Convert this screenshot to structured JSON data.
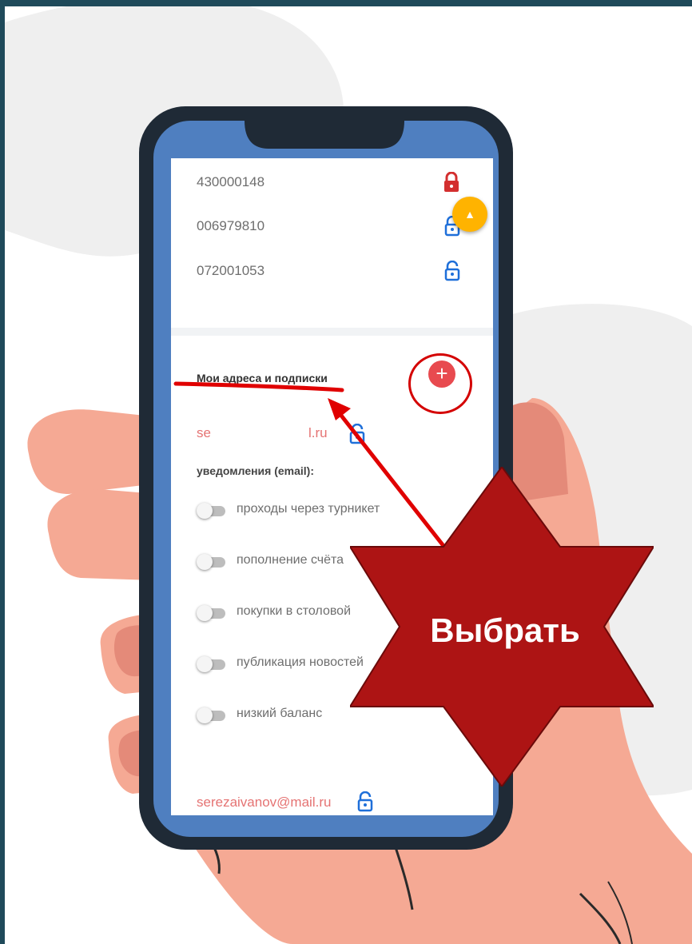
{
  "cards": [
    {
      "number": "430000148",
      "lock": "lock-closed-icon",
      "lock_color": "#d32f2f"
    },
    {
      "number": "006979810",
      "lock": "lock-open-icon",
      "lock_color": "#1e6fd9"
    },
    {
      "number": "072001053",
      "lock": "lock-open-icon",
      "lock_color": "#1e6fd9"
    }
  ],
  "fab_icon": "chevron-up-icon",
  "section_title": "Мои адреса и подписки",
  "add_button_icon": "plus-icon",
  "email_masked_start": "se",
  "email_masked_end": "l.ru",
  "notifications_label": "уведомления (email):",
  "toggles": [
    {
      "label": "проходы через турникет",
      "on": false
    },
    {
      "label": "пополнение счёта",
      "on": false
    },
    {
      "label": "покупки в столовой",
      "on": false
    },
    {
      "label": "публикация новостей",
      "on": false
    },
    {
      "label": "низкий баланс",
      "on": false
    }
  ],
  "email2": "serezaivanov@mail.ru",
  "callout_text": "Выбрать",
  "colors": {
    "phone_body": "#1f2a36",
    "screen_frame": "#4f7fc0",
    "hand": "#f5a994",
    "hand_dark": "#e48a79",
    "star": "#ad1414",
    "annotation_red": "#e00000",
    "accent_blue": "#1e6fd9",
    "fab": "#ffb300",
    "add_button": "#e84a4f"
  }
}
